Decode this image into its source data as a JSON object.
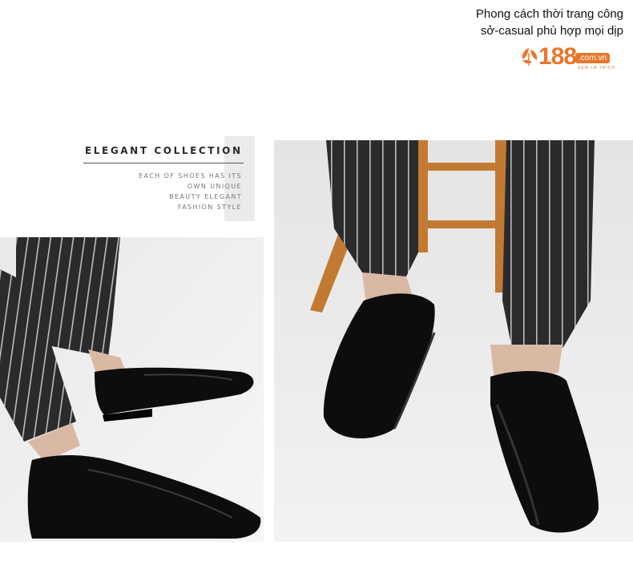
{
  "caption": {
    "line1": "Phong cách thời trang công",
    "line2": "sở-casual phù hợp mọi dịp"
  },
  "logo": {
    "number": "188",
    "domain": ".com.vn",
    "tagline": "XEM LÀ THÍCH"
  },
  "collection": {
    "title": "ELEGANT COLLECTION",
    "desc_lines": [
      "EACH OF SHOES HAS ITS",
      "OWN UNIQUE",
      "BEAUTY ELEGANT",
      "FASHION STYLE"
    ]
  },
  "colors": {
    "accent": "#e8762b",
    "background": "#ffffff",
    "shoe": "#0d0d0d",
    "trouser": "#2b2b2d",
    "wood": "#c27a32"
  },
  "photos": [
    {
      "name": "left-photo",
      "subject": "black-brogue-shoes-striped-trousers-side"
    },
    {
      "name": "right-photo",
      "subject": "black-brogue-shoes-wooden-chair-front"
    }
  ]
}
